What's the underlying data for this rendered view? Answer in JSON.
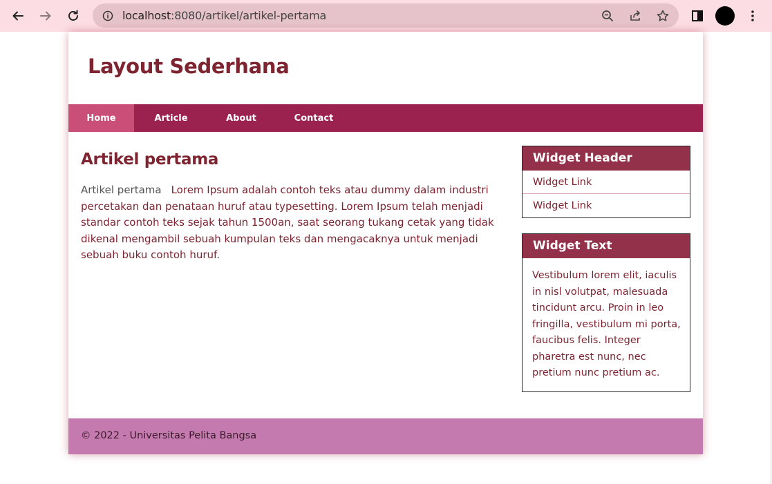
{
  "browser": {
    "url_host": "localhost",
    "url_rest": ":8080/artikel/artikel-pertama",
    "avatar_color": "#000000",
    "toolbar_color": "#fddde4",
    "icons": [
      "back-icon",
      "forward-icon",
      "reload-icon",
      "info-icon",
      "zoom-out-icon",
      "share-icon",
      "star-icon",
      "side-panel-icon",
      "profile-avatar",
      "menu-icon"
    ]
  },
  "site": {
    "title": "Layout Sederhana",
    "nav": [
      {
        "label": "Home",
        "active": true
      },
      {
        "label": "Article",
        "active": false
      },
      {
        "label": "About",
        "active": false
      },
      {
        "label": "Contact",
        "active": false
      }
    ],
    "colors": {
      "nav_bg": "#9b214e",
      "nav_active": "#c94f78",
      "title": "#7e2431",
      "widget_header": "#93304a",
      "footer": "#c47aaf"
    }
  },
  "article": {
    "title": "Artikel pertama",
    "image_alt": "Artikel pertama",
    "body": "Lorem Ipsum adalah contoh teks atau dummy dalam industri percetakan dan penataan huruf atau typesetting. Lorem Ipsum telah menjadi standar contoh teks sejak tahun 1500an, saat seorang tukang cetak yang tidak dikenal mengambil sebuah kumpulan teks dan mengacaknya untuk menjadi sebuah buku contoh huruf."
  },
  "sidebar": {
    "widget1": {
      "header": "Widget Header",
      "links": [
        "Widget Link",
        "Widget Link"
      ]
    },
    "widget2": {
      "header": "Widget Text",
      "text": "Vestibulum lorem elit, iaculis in nisl volutpat, malesuada tincidunt arcu. Proin in leo fringilla, vestibulum mi porta, faucibus felis. Integer pharetra est nunc, nec pretium nunc pretium ac."
    }
  },
  "footer": {
    "text": "© 2022 - Universitas Pelita Bangsa"
  }
}
